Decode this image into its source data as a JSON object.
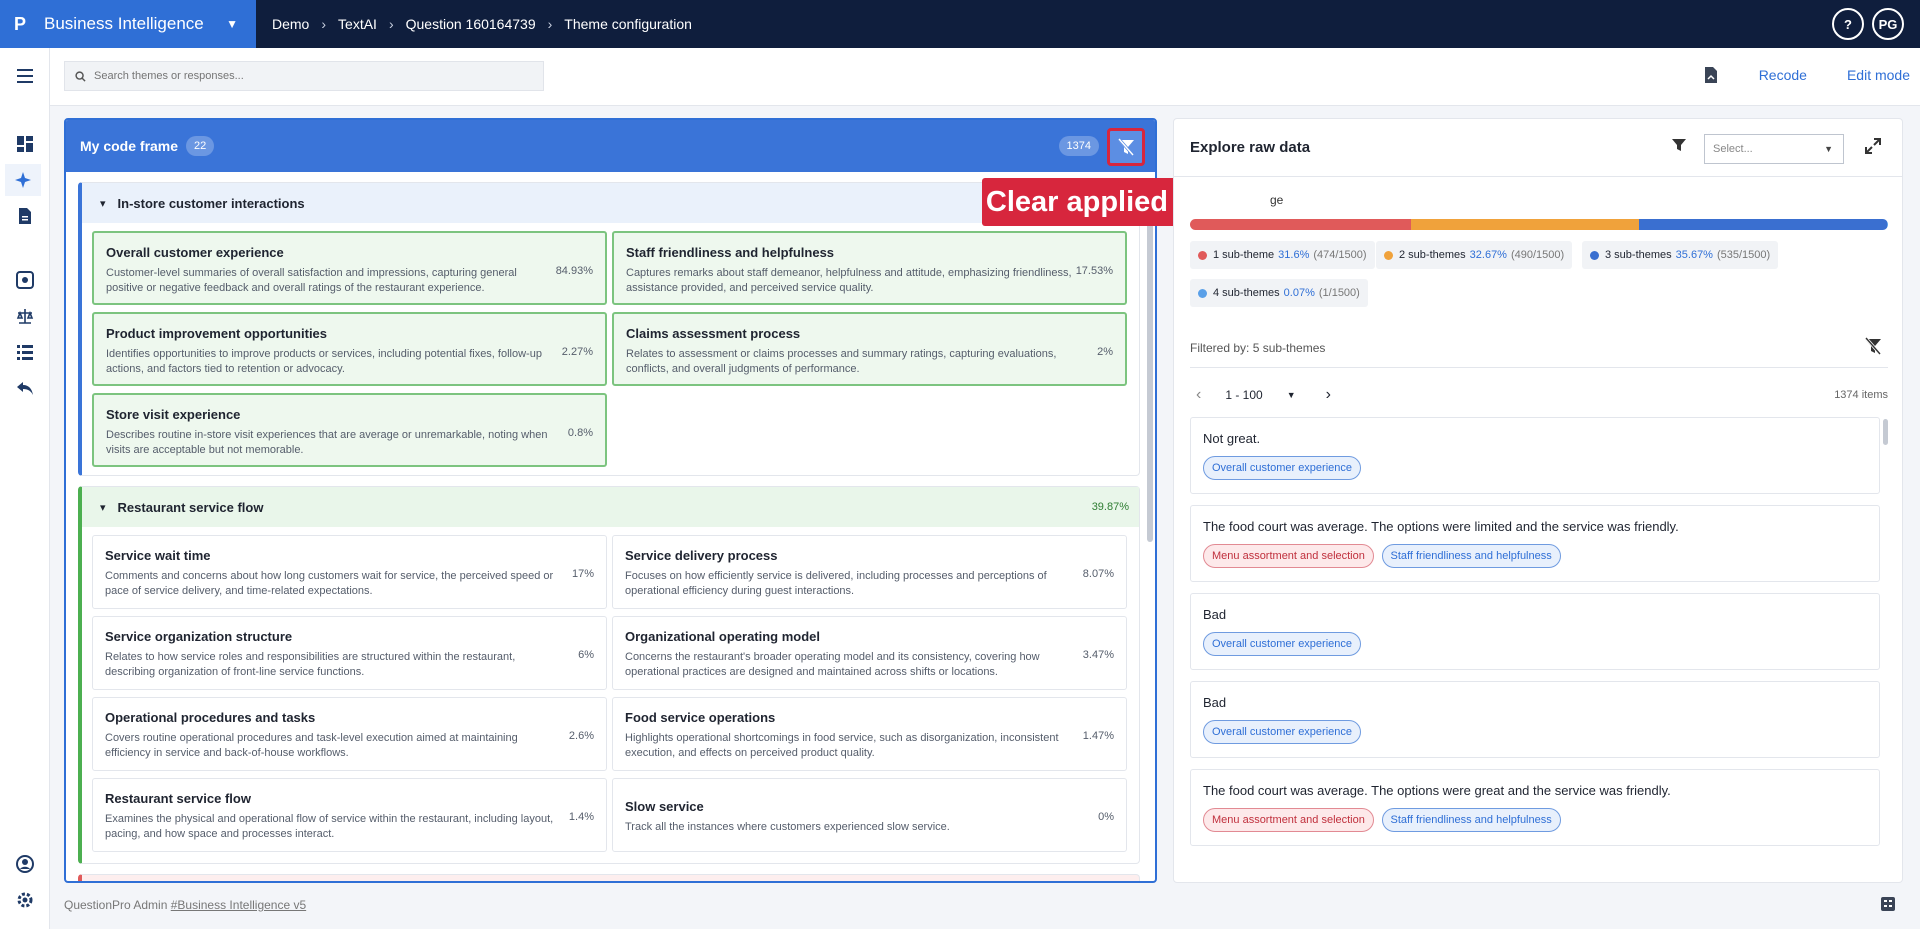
{
  "topbar": {
    "logo": "P",
    "app_name": "Business Intelligence",
    "breadcrumbs": [
      "Demo",
      "TextAI",
      "Question 160164739",
      "Theme configuration"
    ],
    "help": "?",
    "avatar": "PG"
  },
  "toolbar": {
    "search_placeholder": "Search themes or responses...",
    "recode_label": "Recode",
    "edit_mode_label": "Edit mode"
  },
  "code_frame": {
    "title": "My code frame",
    "theme_count": "22",
    "response_count": "1374",
    "groups": [
      {
        "name": "In-store customer interactions",
        "pct": "",
        "cards": [
          {
            "title": "Overall customer experience",
            "desc": "Customer-level summaries of overall satisfaction and impressions, capturing general positive or negative feedback and overall ratings of the restaurant experience.",
            "pct": "84.93%"
          },
          {
            "title": "Staff friendliness and helpfulness",
            "desc": "Captures remarks about staff demeanor, helpfulness and attitude, emphasizing friendliness, assistance provided, and perceived service quality.",
            "pct": "17.53%"
          },
          {
            "title": "Product improvement opportunities",
            "desc": "Identifies opportunities to improve products or services, including potential fixes, follow-up actions, and factors tied to retention or advocacy.",
            "pct": "2.27%"
          },
          {
            "title": "Claims assessment process",
            "desc": "Relates to assessment or claims processes and summary ratings, capturing evaluations, conflicts, and overall judgments of performance.",
            "pct": "2%"
          },
          {
            "title": "Store visit experience",
            "desc": "Describes routine in-store visit experiences that are average or unremarkable, noting when visits are acceptable but not memorable.",
            "pct": "0.8%"
          }
        ]
      },
      {
        "name": "Restaurant service flow",
        "pct": "39.87%",
        "cards": [
          {
            "title": "Service wait time",
            "desc": "Comments and concerns about how long customers wait for service, the perceived speed or pace of service delivery, and time-related expectations.",
            "pct": "17%"
          },
          {
            "title": "Service delivery process",
            "desc": "Focuses on how efficiently service is delivered, including processes and perceptions of operational efficiency during guest interactions.",
            "pct": "8.07%"
          },
          {
            "title": "Service organization structure",
            "desc": "Relates to how service roles and responsibilities are structured within the restaurant, describing organization of front-line service functions.",
            "pct": "6%"
          },
          {
            "title": "Organizational operating model",
            "desc": "Concerns the restaurant's broader operating model and its consistency, covering how operational practices are designed and maintained across shifts or locations.",
            "pct": "3.47%"
          },
          {
            "title": "Operational procedures and tasks",
            "desc": "Covers routine operational procedures and task-level execution aimed at maintaining efficiency in service and back-of-house workflows.",
            "pct": "2.6%"
          },
          {
            "title": "Food service operations",
            "desc": "Highlights operational shortcomings in food service, such as disorganization, inconsistent execution, and effects on perceived product quality.",
            "pct": "1.47%"
          },
          {
            "title": "Restaurant service flow",
            "desc": "Examines the physical and operational flow of service within the restaurant, including layout, pacing, and how space and processes interact.",
            "pct": "1.4%"
          },
          {
            "title": "Slow service",
            "desc": "Track all the instances where customers experienced slow service.",
            "pct": "0%"
          }
        ]
      }
    ]
  },
  "callout": {
    "text": "Clear applied filters."
  },
  "explore": {
    "title": "Explore raw data",
    "select_placeholder": "Select...",
    "coverage_label": "ge",
    "segments": [
      {
        "label": "1 sub-theme",
        "pct": "31.6%",
        "ratio": "(474/1500)",
        "value": 31.6,
        "color": "#e05a5a"
      },
      {
        "label": "2 sub-themes",
        "pct": "32.67%",
        "ratio": "(490/1500)",
        "value": 32.67,
        "color": "#f0a23b"
      },
      {
        "label": "3 sub-themes",
        "pct": "35.67%",
        "ratio": "(535/1500)",
        "value": 35.67,
        "color": "#3a6fd0"
      },
      {
        "label": "4 sub-themes",
        "pct": "0.07%",
        "ratio": "(1/1500)",
        "value": 0.07,
        "color": "#5aa0e8"
      }
    ],
    "filtered_by": "Filtered by: 5 sub-themes",
    "page_range": "1 - 100",
    "items_count": "1374 items",
    "responses": [
      {
        "text": "Not great.",
        "tags": [
          {
            "label": "Overall customer experience",
            "tone": "blue"
          }
        ]
      },
      {
        "text": "The food court was average. The options were limited and the service was friendly.",
        "tags": [
          {
            "label": "Menu assortment and selection",
            "tone": "red"
          },
          {
            "label": "Staff friendliness and helpfulness",
            "tone": "blue"
          }
        ]
      },
      {
        "text": "Bad",
        "tags": [
          {
            "label": "Overall customer experience",
            "tone": "blue"
          }
        ]
      },
      {
        "text": "Bad",
        "tags": [
          {
            "label": "Overall customer experience",
            "tone": "blue"
          }
        ]
      },
      {
        "text": "The food court was average. The options were great and the service was friendly.",
        "tags": [
          {
            "label": "Menu assortment and selection",
            "tone": "red"
          },
          {
            "label": "Staff friendliness and helpfulness",
            "tone": "blue"
          }
        ]
      }
    ]
  },
  "footer": {
    "prefix": "QuestionPro Admin",
    "link": "#Business Intelligence v5"
  }
}
